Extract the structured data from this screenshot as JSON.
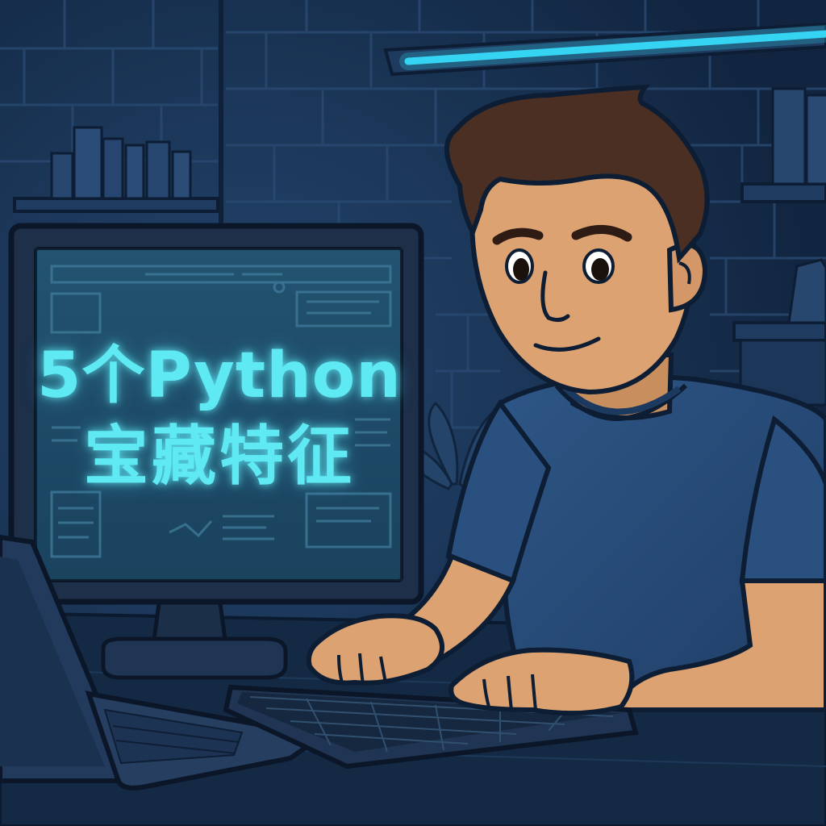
{
  "screen": {
    "title_line1": "5个Python",
    "title_line2": "宝藏特征"
  },
  "colors": {
    "wall": "#1a3556",
    "desk": "#14283f",
    "screen_glow": "#5ee9f3",
    "shirt": "#284c7a",
    "skin": "#dca271",
    "hair": "#4a2f22",
    "ceiling_light": "#35d4f2"
  },
  "icons": [
    "desktop-monitor",
    "laptop",
    "keyboard",
    "potted-plant",
    "ceiling-light",
    "books"
  ]
}
